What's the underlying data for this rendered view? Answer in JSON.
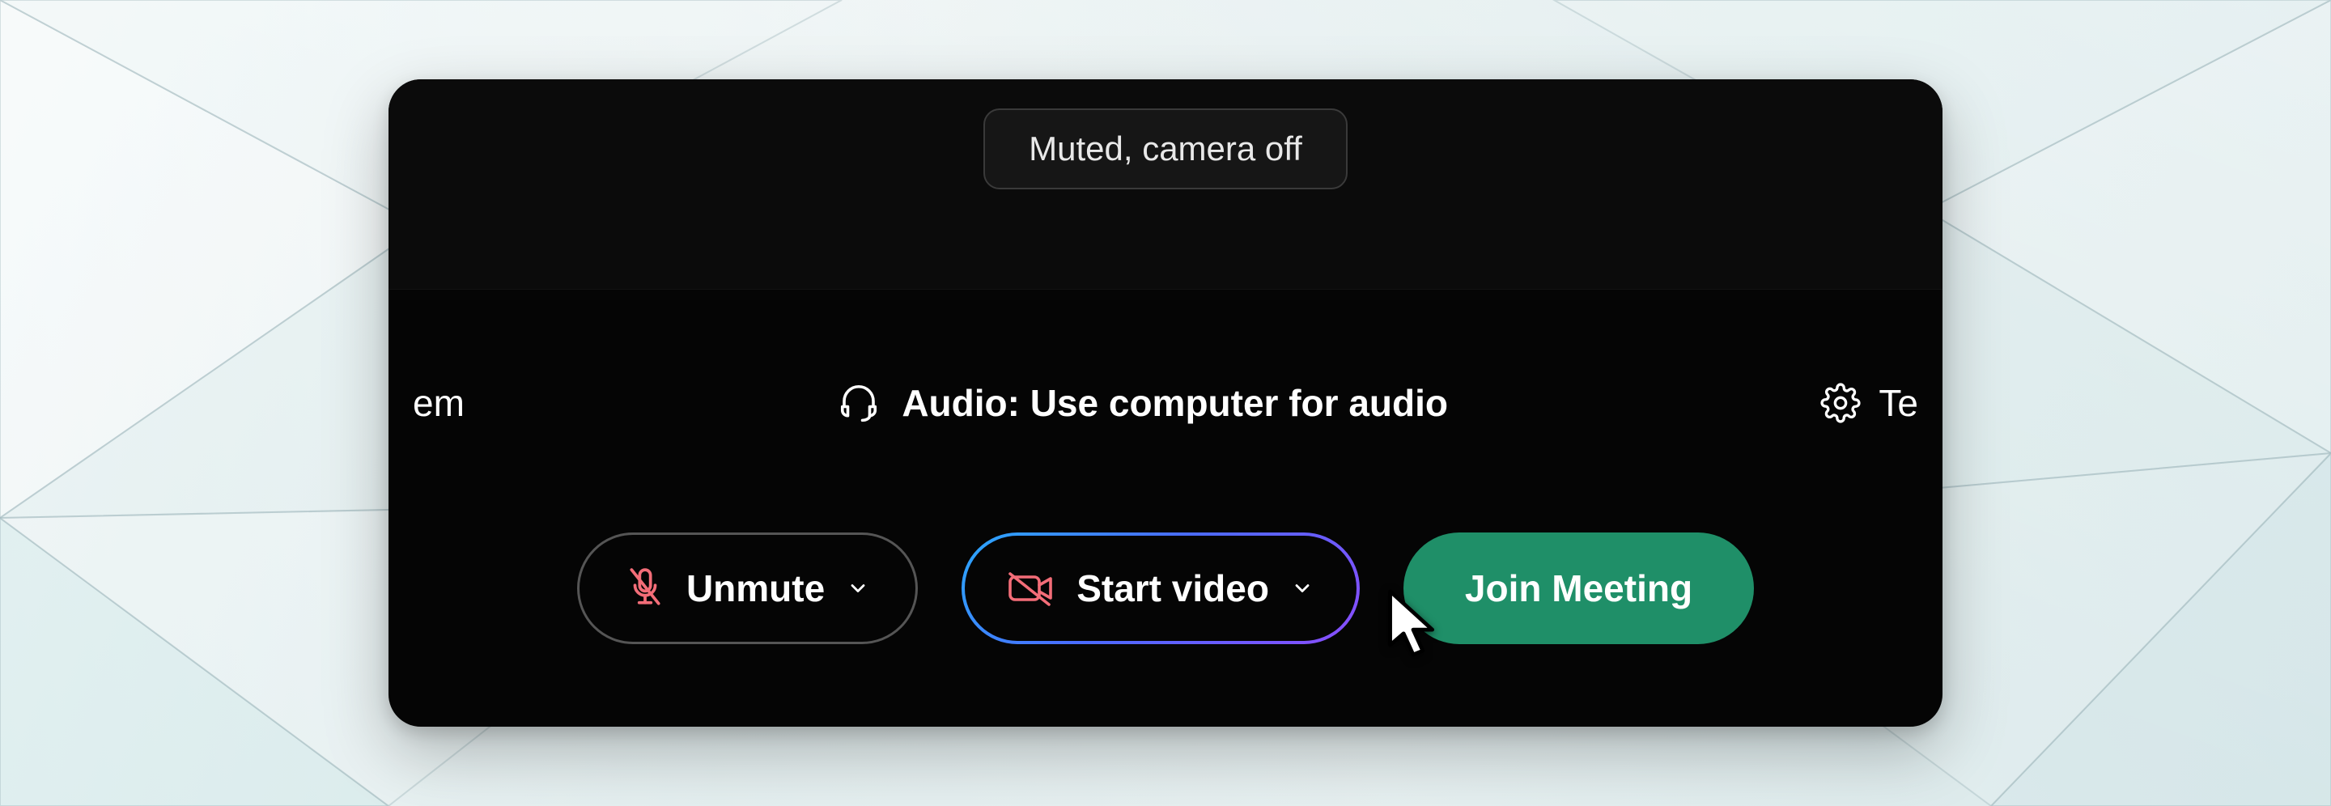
{
  "status": {
    "label": "Muted, camera off"
  },
  "audio": {
    "left_fragment": "em",
    "center_label": "Audio: Use computer for audio",
    "right_fragment": "Te"
  },
  "buttons": {
    "unmute": {
      "label": "Unmute"
    },
    "start_video": {
      "label": "Start video"
    },
    "join": {
      "label": "Join Meeting"
    }
  },
  "icons": {
    "headset": "headset-icon",
    "gear": "gear-icon",
    "mic_off": "mic-off-icon",
    "camera_off": "camera-off-icon",
    "chevron_down": "chevron-down-icon",
    "cursor": "cursor-icon"
  },
  "colors": {
    "danger_stroke": "#f36d78",
    "join_bg": "#1f8f68",
    "grad_a": "#2aa9ff",
    "grad_b": "#8a4dff"
  }
}
